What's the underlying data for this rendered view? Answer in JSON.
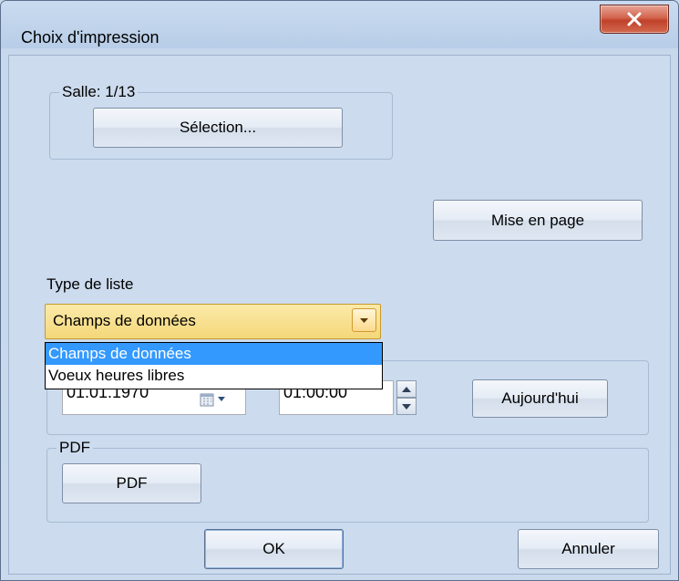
{
  "window": {
    "title": "Choix d'impression"
  },
  "salle": {
    "label": "Salle: 1/13",
    "select_button": "Sélection..."
  },
  "layout_button": "Mise en page",
  "list_type": {
    "label": "Type de liste",
    "selected": "Champs de données",
    "options": [
      "Champs de données",
      "Voeux heures libres"
    ]
  },
  "date_time": {
    "date": "01.01.1970",
    "time": "01:00:00",
    "today_button": "Aujourd'hui"
  },
  "pdf": {
    "group_label": "PDF",
    "button": "PDF"
  },
  "footer": {
    "ok": "OK",
    "cancel": "Annuler"
  }
}
